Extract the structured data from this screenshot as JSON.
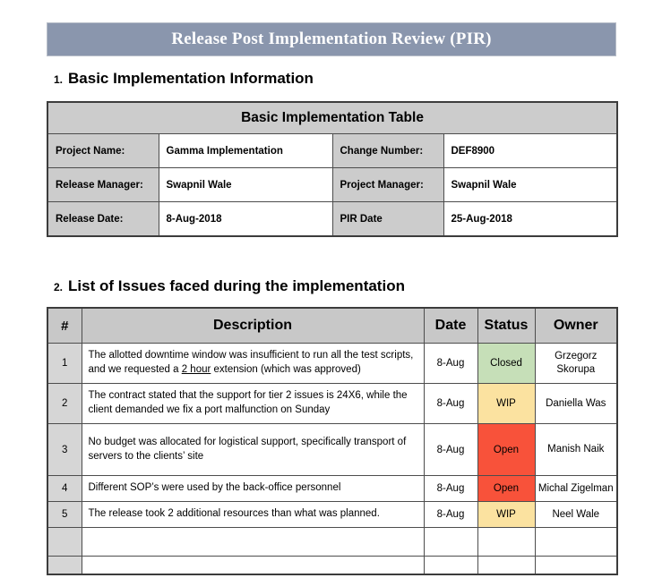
{
  "document": {
    "title": "Release Post Implementation Review (PIR)",
    "banner_color": "#8a96ad",
    "header_cell_color": "#cccccc"
  },
  "sections": {
    "basic": {
      "number": "1.",
      "heading": "Basic Implementation Information",
      "table_title": "Basic Implementation Table",
      "rows": [
        {
          "label_left": "Project Name:",
          "value_left": "Gamma Implementation",
          "label_right": "Change Number:",
          "value_right": "DEF8900"
        },
        {
          "label_left": "Release Manager:",
          "value_left": "Swapnil Wale",
          "label_right": "Project Manager:",
          "value_right": "Swapnil Wale"
        },
        {
          "label_left": "Release Date:",
          "value_left": "8-Aug-2018",
          "label_right": "PIR Date",
          "value_right": "25-Aug-2018"
        }
      ]
    },
    "issues": {
      "number": "2.",
      "heading": "List of Issues faced during the implementation",
      "columns": {
        "hash": "#",
        "description": "Description",
        "date": "Date",
        "status": "Status",
        "owner": "Owner"
      },
      "status_colors": {
        "Closed": "#c6dfb8",
        "WIP": "#fbe2a0",
        "Open": "#f8523a",
        "empty": "#ffffff"
      },
      "rows": [
        {
          "index": "1",
          "description_pre": "The allotted downtime window was insufficient to run all the test scripts, and we requested a ",
          "description_link": "2 hour",
          "description_post": " extension (which was approved)",
          "date": "8-Aug",
          "status": "Closed",
          "owner": "Grzegorz Skorupa"
        },
        {
          "index": "2",
          "description_pre": "The contract stated that the support for tier 2 issues is 24X6, while the client demanded we fix a port malfunction on Sunday",
          "description_link": "",
          "description_post": "",
          "date": "8-Aug",
          "status": "WIP",
          "owner": "Daniella Was"
        },
        {
          "index": "3",
          "description_pre": "No budget was allocated for logistical support, specifically transport of servers to the clients’ site",
          "description_link": "",
          "description_post": "",
          "date": "8-Aug",
          "status": "Open",
          "owner": "Manish Naik"
        },
        {
          "index": "4",
          "description_pre": "Different SOP’s were used by the back-office personnel",
          "description_link": "",
          "description_post": "",
          "date": "8-Aug",
          "status": "Open",
          "owner": "Michal Zigelman"
        },
        {
          "index": "5",
          "description_pre": "The release took 2 additional resources than what was planned.",
          "description_link": "",
          "description_post": "",
          "date": "8-Aug",
          "status": "WIP",
          "owner": "Neel Wale"
        },
        {
          "index": "",
          "description_pre": "",
          "description_link": "",
          "description_post": "",
          "date": "",
          "status": "",
          "owner": ""
        },
        {
          "index": "",
          "description_pre": "",
          "description_link": "",
          "description_post": "",
          "date": "",
          "status": "",
          "owner": ""
        }
      ]
    }
  }
}
